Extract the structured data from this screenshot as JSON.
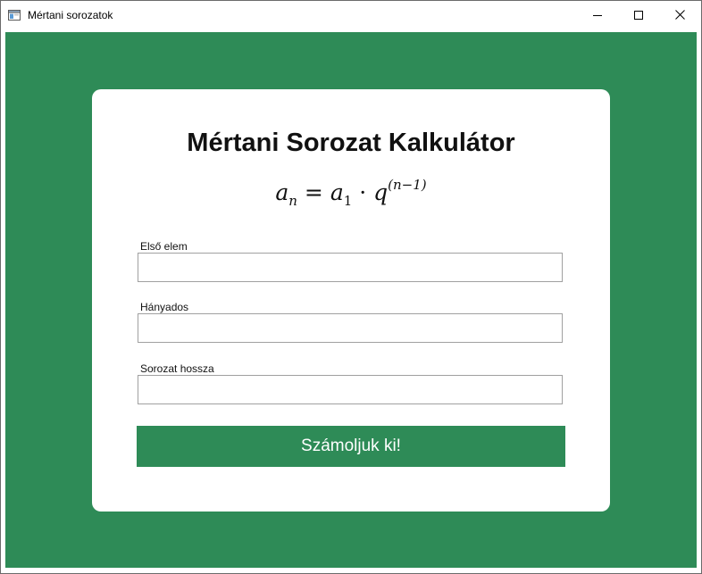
{
  "window": {
    "title": "Mértani sorozatok",
    "controls": [
      "minimize",
      "maximize",
      "close"
    ]
  },
  "colors": {
    "background_green": "#2e8b57",
    "card": "#ffffff",
    "button": "#2e8b57",
    "button_text": "#ffffff"
  },
  "card": {
    "heading": "Mértani Sorozat Kalkulátor",
    "formula": {
      "lhs_var": "a",
      "lhs_sub": "n",
      "eq": "=",
      "rhs_var": "a",
      "rhs_sub": "1",
      "dot": "·",
      "base": "q",
      "exponent": "(n−1)"
    },
    "fields": [
      {
        "label": "Első elem",
        "value": "",
        "placeholder": ""
      },
      {
        "label": "Hányados",
        "value": "",
        "placeholder": ""
      },
      {
        "label": "Sorozat hossza",
        "value": "",
        "placeholder": ""
      }
    ],
    "submit_label": "Számoljuk ki!"
  }
}
